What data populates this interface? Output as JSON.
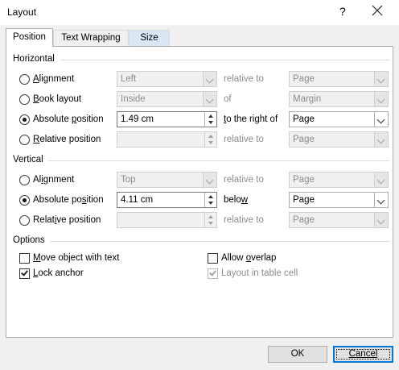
{
  "window": {
    "title": "Layout",
    "help": "?"
  },
  "tabs": [
    "Position",
    "Text Wrapping",
    "Size"
  ],
  "horizontal": {
    "heading": "Horizontal",
    "alignment": {
      "label_u": "A",
      "label_rest": "lignment",
      "value": "Left",
      "relation": "relative to",
      "target": "Page"
    },
    "book_layout": {
      "label_u": "B",
      "label_rest": "ook layout",
      "value": "Inside",
      "relation": "of",
      "target": "Margin"
    },
    "absolute": {
      "label_pre": "Absolute ",
      "label_u": "p",
      "label_rest": "osition",
      "value": "1.49 cm",
      "relation_u": "t",
      "relation_rest": "o the right of",
      "target": "Page"
    },
    "relative": {
      "label_u": "R",
      "label_rest": "elative position",
      "value": "",
      "relation": "relative to",
      "target": "Page"
    }
  },
  "vertical": {
    "heading": "Vertical",
    "alignment": {
      "label_pre": "Al",
      "label_u": "i",
      "label_rest": "gnment",
      "value": "Top",
      "relation": "relative to",
      "target": "Page"
    },
    "absolute": {
      "label_pre": "Absolute po",
      "label_u": "s",
      "label_rest": "ition",
      "value": "4.11 cm",
      "relation_pre": "belo",
      "relation_u": "w",
      "target": "Page"
    },
    "relative": {
      "label_pre": "Relat",
      "label_u": "i",
      "label_rest": "ve position",
      "value": "",
      "relation": "relative to",
      "target": "Page"
    }
  },
  "options": {
    "heading": "Options",
    "move_object": {
      "label_u": "M",
      "label_rest": "ove object with text",
      "checked": false
    },
    "lock_anchor": {
      "label_u": "L",
      "label_rest": "ock anchor",
      "checked": true
    },
    "allow_overlap": {
      "label_pre": "Allow ",
      "label_u": "o",
      "label_rest": "verlap",
      "checked": false
    },
    "layout_in_cell": {
      "label": "Layout in table cell",
      "checked": true
    }
  },
  "buttons": {
    "ok": "OK",
    "cancel": "Cancel"
  }
}
